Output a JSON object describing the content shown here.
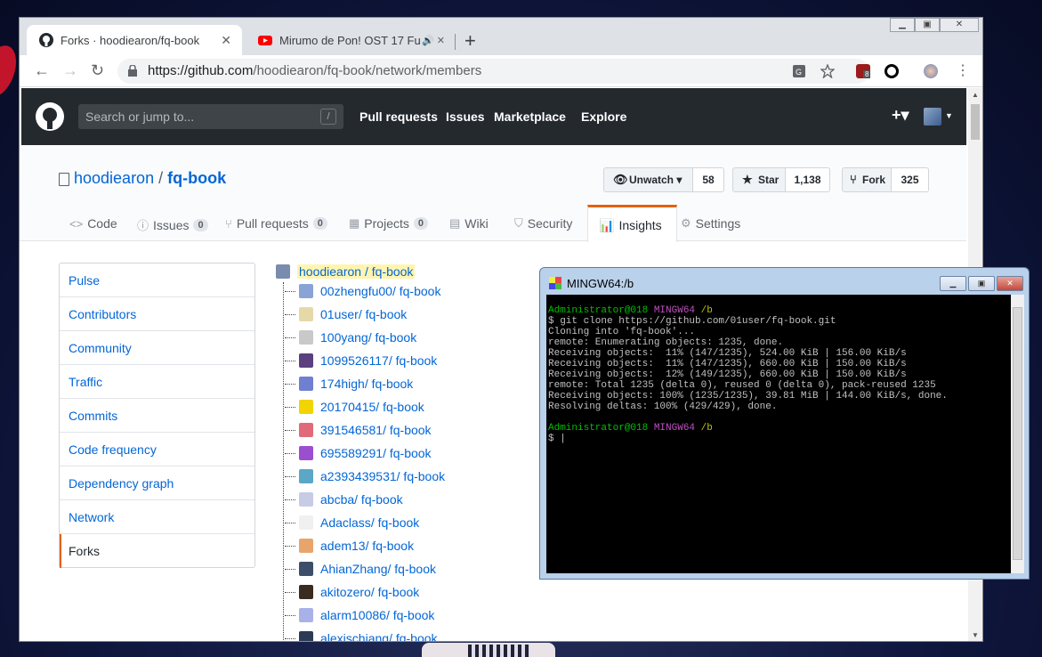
{
  "browser": {
    "tab1_title": "Forks · hoodiearon/fq-book",
    "tab2_title": "Mirumo de Pon! OST 17 Fu",
    "url_host": "https://github.com",
    "url_path": "/hoodiearon/fq-book/network/members",
    "badge_count": "8"
  },
  "github": {
    "search_placeholder": "Search or jump to...",
    "slash": "/",
    "nav": [
      "Pull requests",
      "Issues",
      "Marketplace",
      "Explore"
    ],
    "plus": "+▾"
  },
  "repo": {
    "owner": "hoodiearon",
    "sep": " / ",
    "name": "fq-book",
    "watch_label": "Unwatch ▾",
    "watch_count": "58",
    "star_label": "Star",
    "star_count": "1,138",
    "fork_label": "Fork",
    "fork_count": "325",
    "tabs": {
      "code": "Code",
      "issues": "Issues",
      "issues_count": "0",
      "pulls": "Pull requests",
      "pulls_count": "0",
      "projects": "Projects",
      "projects_count": "0",
      "wiki": "Wiki",
      "security": "Security",
      "insights": "Insights",
      "settings": "Settings"
    }
  },
  "menu": [
    "Pulse",
    "Contributors",
    "Community",
    "Traffic",
    "Commits",
    "Code frequency",
    "Dependency graph",
    "Network",
    "Forks"
  ],
  "tree": {
    "root": "hoodiearon / fq-book",
    "forks": [
      {
        "user": "00zhengfu00",
        "repo": " / fq-book",
        "color": "#8aa3d6"
      },
      {
        "user": "01user",
        "repo": " / fq-book",
        "color": "#e6d9a8"
      },
      {
        "user": "100yang",
        "repo": " / fq-book",
        "color": "#c9c9c9"
      },
      {
        "user": "1099526117",
        "repo": " / fq-book",
        "color": "#5b3f7e"
      },
      {
        "user": "174high",
        "repo": " / fq-book",
        "color": "#6f7fd1"
      },
      {
        "user": "20170415",
        "repo": " / fq-book",
        "color": "#f1d400"
      },
      {
        "user": "391546581",
        "repo": " / fq-book",
        "color": "#e06a7a"
      },
      {
        "user": "695589291",
        "repo": " / fq-book",
        "color": "#9a4fd0"
      },
      {
        "user": "a2393439531",
        "repo": " / fq-book",
        "color": "#5aa7c8"
      },
      {
        "user": "abcba",
        "repo": " / fq-book",
        "color": "#c7cbe6"
      },
      {
        "user": "Adaclass",
        "repo": " / fq-book",
        "color": "#f0f0f0"
      },
      {
        "user": "adem13",
        "repo": " / fq-book",
        "color": "#e8a56b"
      },
      {
        "user": "AhianZhang",
        "repo": " / fq-book",
        "color": "#3c4e6a"
      },
      {
        "user": "akitozero",
        "repo": " / fq-book",
        "color": "#3a2b20"
      },
      {
        "user": "alarm10086",
        "repo": " / fq-book",
        "color": "#a9b2e8"
      },
      {
        "user": "alexischiang",
        "repo": " / fq-book",
        "color": "#2d3a56"
      }
    ]
  },
  "terminal": {
    "title": "MINGW64:/b",
    "prompt_user": "Administrator@018",
    "prompt_sys": "MINGW64",
    "prompt_dir": "/b",
    "command": "$ git clone https://github.com/01user/fq-book.git",
    "output": [
      "Cloning into 'fq-book'...",
      "remote: Enumerating objects: 1235, done.",
      "Receiving objects:  11% (147/1235), 524.00 KiB | 156.00 KiB/s",
      "Receiving objects:  11% (147/1235), 660.00 KiB | 150.00 KiB/s",
      "Receiving objects:  12% (149/1235), 660.00 KiB | 150.00 KiB/s",
      "remote: Total 1235 (delta 0), reused 0 (delta 0), pack-reused 1235",
      "Receiving objects: 100% (1235/1235), 39.81 MiB | 144.00 KiB/s, done.",
      "Resolving deltas: 100% (429/429), done."
    ],
    "prompt2": "$ |"
  }
}
